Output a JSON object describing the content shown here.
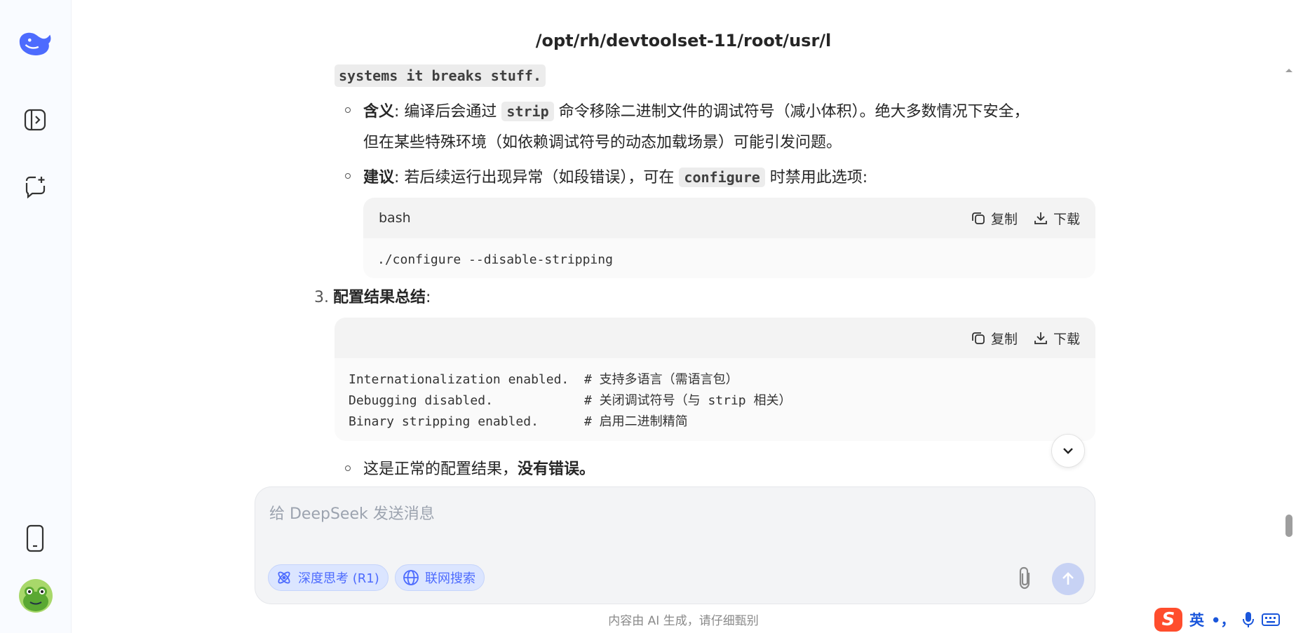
{
  "page": {
    "title": "/opt/rh/devtoolset-11/root/usr/l"
  },
  "content": {
    "fragment_code": "systems it breaks stuff.",
    "bullet_meaning": {
      "label": "含义",
      "pre": ": 编译后会通过 ",
      "code": "strip",
      "post": " 命令移除二进制文件的调试符号（减小体积）。绝大多数情况下安全，",
      "line2": "但在某些特殊环境（如依赖调试符号的动态加载场景）可能引发问题。"
    },
    "bullet_suggest": {
      "label": "建议",
      "pre": ": 若后续运行出现异常（如段错误），可在 ",
      "code": "configure",
      "post": " 时禁用此选项:"
    },
    "code1": {
      "lang": "bash",
      "copy": "复制",
      "download": "下载",
      "code": "./configure --disable-stripping"
    },
    "section3": {
      "num": "3.",
      "title": "配置结果总结",
      "colon": ":"
    },
    "code2": {
      "lang": "",
      "copy": "复制",
      "download": "下载",
      "code": "Internationalization enabled.  # 支持多语言（需语言包）\nDebugging disabled.            # 关闭调试符号（与 strip 相关）\nBinary stripping enabled.      # 启用二进制精简"
    },
    "bullet_normal": {
      "pre": "这是正常的配置结果，",
      "bold": "没有错误。"
    }
  },
  "composer": {
    "placeholder": "给 DeepSeek 发送消息",
    "deep_think": "深度思考 (R1)",
    "web_search": "联网搜索"
  },
  "footer": {
    "disclaimer": "内容由 AI 生成，请仔细甄别"
  },
  "ime": {
    "lang": "英",
    "punct": "•，"
  },
  "colors": {
    "accent": "#4d6bfe",
    "ime_logo": "#ff4d2d"
  }
}
